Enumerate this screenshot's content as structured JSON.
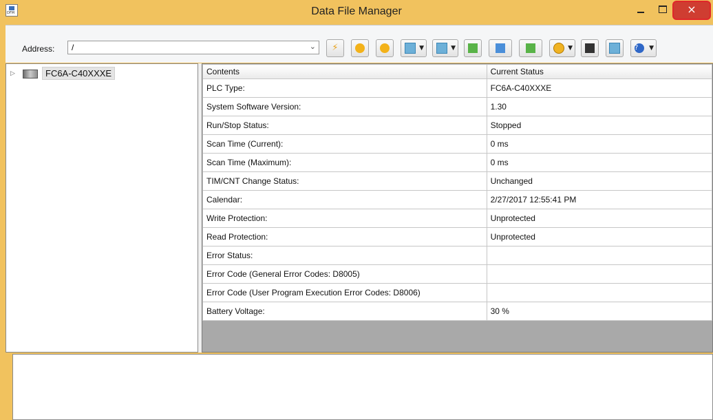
{
  "window": {
    "title": "Data File Manager",
    "app_icon_text": "DFM",
    "close_glyph": "×"
  },
  "toolbar": {
    "address_label": "Address:",
    "address_value": "/",
    "buttons": [
      {
        "name": "download-button",
        "icon": "lightning-icon"
      },
      {
        "name": "run-button",
        "icon": "run-icon"
      },
      {
        "name": "stop-button",
        "icon": "stop-icon"
      },
      {
        "name": "view-button-1",
        "icon": "window-icon",
        "dropdown": true
      },
      {
        "name": "view-button-2",
        "icon": "window-icon",
        "dropdown": true
      },
      {
        "name": "transfer-button",
        "icon": "transfer-icon"
      },
      {
        "name": "import-button",
        "icon": "import-arrow-icon"
      },
      {
        "name": "export-button",
        "icon": "export-arrow-icon"
      },
      {
        "name": "globe-button",
        "icon": "globe-icon",
        "dropdown": true
      },
      {
        "name": "save-button",
        "icon": "save-icon"
      },
      {
        "name": "edit-button",
        "icon": "edit-icon"
      },
      {
        "name": "help-button",
        "icon": "help-icon",
        "dropdown": true
      }
    ]
  },
  "tree": {
    "root_label": "FC6A-C40XXXE"
  },
  "status_table": {
    "headers": [
      "Contents",
      "Current Status"
    ],
    "rows": [
      [
        "PLC Type:",
        "FC6A-C40XXXE"
      ],
      [
        "System Software Version:",
        "1.30"
      ],
      [
        "Run/Stop Status:",
        "Stopped"
      ],
      [
        "Scan Time (Current):",
        "0 ms"
      ],
      [
        "Scan Time (Maximum):",
        "0 ms"
      ],
      [
        "TIM/CNT Change Status:",
        "Unchanged"
      ],
      [
        "Calendar:",
        "2/27/2017 12:55:41 PM"
      ],
      [
        "Write Protection:",
        "Unprotected"
      ],
      [
        "Read Protection:",
        "Unprotected"
      ],
      [
        "Error Status:",
        ""
      ],
      [
        "Error Code (General Error Codes: D8005)",
        ""
      ],
      [
        "Error Code (User Program Execution Error Codes: D8006)",
        ""
      ],
      [
        "Battery Voltage:",
        "30 %"
      ]
    ]
  },
  "colors": {
    "window_frame": "#f1c25e",
    "close_button": "#cf3d31",
    "close_highlight": "#e0262a"
  }
}
